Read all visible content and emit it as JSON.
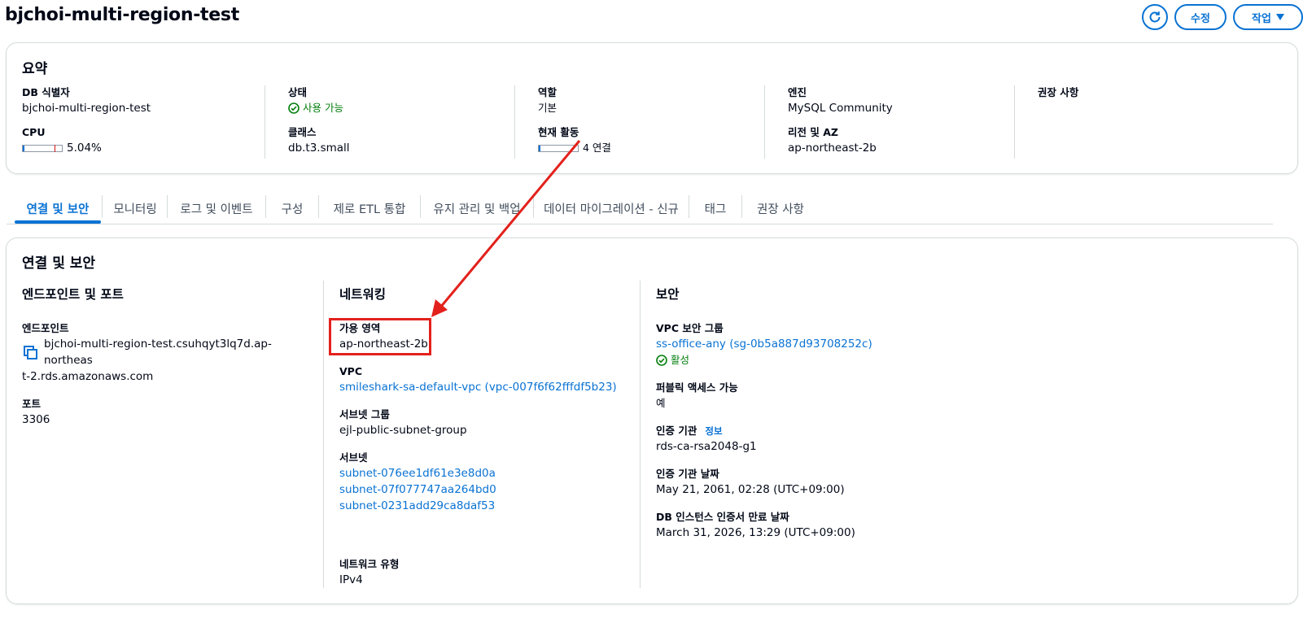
{
  "header": {
    "title": "bjchoi-multi-region-test",
    "edit_label": "수정",
    "actions_label": "작업"
  },
  "summary": {
    "title": "요약",
    "db_id_label": "DB 식별자",
    "db_id_value": "bjchoi-multi-region-test",
    "cpu_label": "CPU",
    "cpu_value": "5.04%",
    "cpu_fraction": 0.0504,
    "status_label": "상태",
    "status_value": "사용 가능",
    "class_label": "클래스",
    "class_value": "db.t3.small",
    "role_label": "역할",
    "role_value": "기본",
    "activity_label": "현재 활동",
    "activity_value": "4 연결",
    "engine_label": "엔진",
    "engine_value": "MySQL Community",
    "region_label": "리전 및 AZ",
    "region_value": "ap-northeast-2b",
    "recommend_label": "권장 사항"
  },
  "tabs": [
    {
      "label": "연결 및 보안",
      "active": true
    },
    {
      "label": "모니터링"
    },
    {
      "label": "로그 및 이벤트"
    },
    {
      "label": "구성"
    },
    {
      "label": "제로 ETL 통합"
    },
    {
      "label": "유지 관리 및 백업"
    },
    {
      "label": "데이터 마이그레이션 - 신규"
    },
    {
      "label": "태그"
    },
    {
      "label": "권장 사항"
    }
  ],
  "connectivity": {
    "title": "연결 및 보안",
    "endpoint_section": {
      "title": "엔드포인트 및 포트",
      "endpoint_label": "엔드포인트",
      "endpoint_line1": "bjchoi-multi-region-test.csuhqyt3lq7d.ap-northeas",
      "endpoint_line2": "t-2.rds.amazonaws.com",
      "port_label": "포트",
      "port_value": "3306"
    },
    "networking_section": {
      "title": "네트워킹",
      "az_label": "가용 영역",
      "az_value": "ap-northeast-2b",
      "vpc_label": "VPC",
      "vpc_value": "smileshark-sa-default-vpc (vpc-007f6f62fffdf5b23)",
      "subnet_group_label": "서브넷 그룹",
      "subnet_group_value": "ejl-public-subnet-group",
      "subnets_label": "서브넷",
      "subnets": [
        "subnet-076ee1df61e3e8d0a",
        "subnet-07f077747aa264bd0",
        "subnet-0231add29ca8daf53"
      ],
      "network_type_label": "네트워크 유형",
      "network_type_value": "IPv4"
    },
    "security_section": {
      "title": "보안",
      "sg_label": "VPC 보안 그룹",
      "sg_value": "ss-office-any (sg-0b5a887d93708252c)",
      "sg_status": "활성",
      "public_label": "퍼블릭 액세스 가능",
      "public_value": "예",
      "ca_label": "인증 기관",
      "ca_info": "정보",
      "ca_value": "rds-ca-rsa2048-g1",
      "ca_date_label": "인증 기관 날짜",
      "ca_date_value": "May 21, 2061, 02:28 (UTC+09:00)",
      "cert_exp_label": "DB 인스턴스 인증서 만료 날짜",
      "cert_exp_value": "March 31, 2026, 13:29 (UTC+09:00)"
    }
  },
  "colors": {
    "link": "#0972d3",
    "success": "#037f0c",
    "annotation": "#e3211c"
  }
}
